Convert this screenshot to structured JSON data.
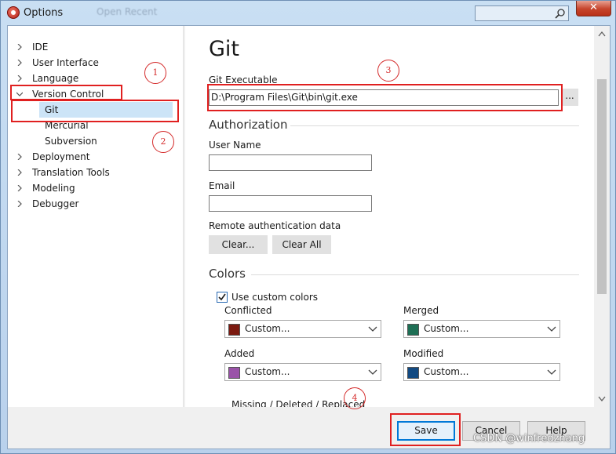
{
  "window": {
    "title": "Options",
    "ghost_text": "Open Recent",
    "close_glyph": "✕",
    "icons": {
      "app": "app-logo-icon",
      "search": "search-icon",
      "close": "close-icon"
    }
  },
  "tree": {
    "items": [
      {
        "label": "IDE",
        "expander": "collapsed"
      },
      {
        "label": "User Interface",
        "expander": "collapsed"
      },
      {
        "label": "Language",
        "expander": "collapsed"
      },
      {
        "label": "Version Control",
        "expander": "expanded"
      },
      {
        "label": "Git",
        "selected": true
      },
      {
        "label": "Mercurial"
      },
      {
        "label": "Subversion"
      },
      {
        "label": "Deployment",
        "expander": "collapsed"
      },
      {
        "label": "Translation Tools",
        "expander": "collapsed"
      },
      {
        "label": "Modeling",
        "expander": "collapsed"
      },
      {
        "label": "Debugger",
        "expander": "collapsed"
      }
    ],
    "selection_color": "#cce4f7"
  },
  "panel": {
    "title": "Git",
    "git_executable": {
      "label": "Git Executable",
      "value": "D:\\Program Files\\Git\\bin\\git.exe",
      "browse_label": "..."
    },
    "authorization": {
      "heading": "Authorization",
      "username_label": "User Name",
      "username_value": "",
      "email_label": "Email",
      "email_value": "",
      "remote_label": "Remote authentication data",
      "clear_label": "Clear...",
      "clear_all_label": "Clear All"
    },
    "colors": {
      "heading": "Colors",
      "use_custom_label": "Use custom colors",
      "use_custom_checked": true,
      "fields": [
        {
          "label": "Conflicted",
          "value": "Custom...",
          "color": "#7b1a10"
        },
        {
          "label": "Merged",
          "value": "Custom...",
          "color": "#1e6f55"
        },
        {
          "label": "Added",
          "value": "Custom...",
          "color": "#9a52a8"
        },
        {
          "label": "Modified",
          "value": "Custom...",
          "color": "#124a82"
        }
      ],
      "partial_label": "Missing / Deleted / Replaced"
    }
  },
  "footer": {
    "save_label": "Save",
    "cancel_label": "Cancel",
    "help_label": "Help"
  },
  "annotations": {
    "callouts": [
      "1",
      "2",
      "3",
      "4"
    ],
    "highlight_color": "#e02020"
  },
  "watermark": "CSDN @winfredzhang"
}
